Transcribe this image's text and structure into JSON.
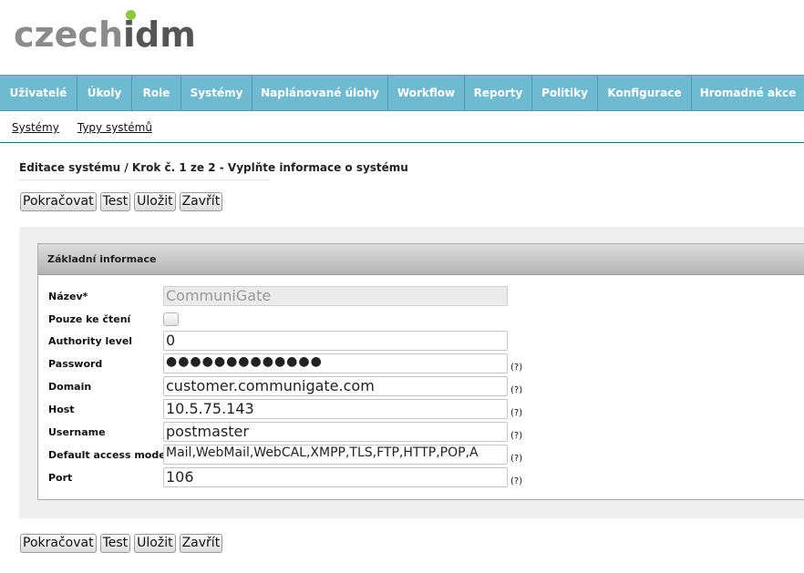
{
  "logo": {
    "part1": "czech",
    "part2": "idm"
  },
  "main_nav": {
    "items": [
      {
        "label": "Uživatelé"
      },
      {
        "label": "Úkoly"
      },
      {
        "label": "Role"
      },
      {
        "label": "Systémy"
      },
      {
        "label": "Naplánované úlohy"
      },
      {
        "label": "Workflow"
      },
      {
        "label": "Reporty"
      },
      {
        "label": "Politiky"
      },
      {
        "label": "Konfigurace"
      },
      {
        "label": "Hromadné akce"
      }
    ]
  },
  "sub_nav": {
    "items": [
      {
        "label": "Systémy"
      },
      {
        "label": "Typy systémů"
      }
    ]
  },
  "page": {
    "title": "Editace systému / Krok č. 1 ze 2 - Vyplňte informace o systému"
  },
  "buttons": {
    "continue": "Pokračovat",
    "test": "Test",
    "save": "Uložit",
    "close": "Zavřít"
  },
  "form": {
    "section_title": "Základní informace",
    "help_marker": "(?)",
    "name": {
      "label": "Název*",
      "value": "CommuniGate"
    },
    "read_only": {
      "label": "Pouze ke čtení",
      "checked": false
    },
    "authority_level": {
      "label": "Authority level",
      "value": "0"
    },
    "password": {
      "label": "Password",
      "value": "●●●●●●●●●●●●●"
    },
    "domain": {
      "label": "Domain",
      "value": "customer.communigate.com"
    },
    "host": {
      "label": "Host",
      "value": "10.5.75.143"
    },
    "username": {
      "label": "Username",
      "value": "postmaster"
    },
    "default_access_modes": {
      "label": "Default access modes",
      "value": "Mail,WebMail,WebCAL,XMPP,TLS,FTP,HTTP,POP,A"
    },
    "port": {
      "label": "Port",
      "value": "106"
    }
  },
  "colors": {
    "nav_bg": "#6fb9d1",
    "logo_dot": "#8dc63f"
  }
}
